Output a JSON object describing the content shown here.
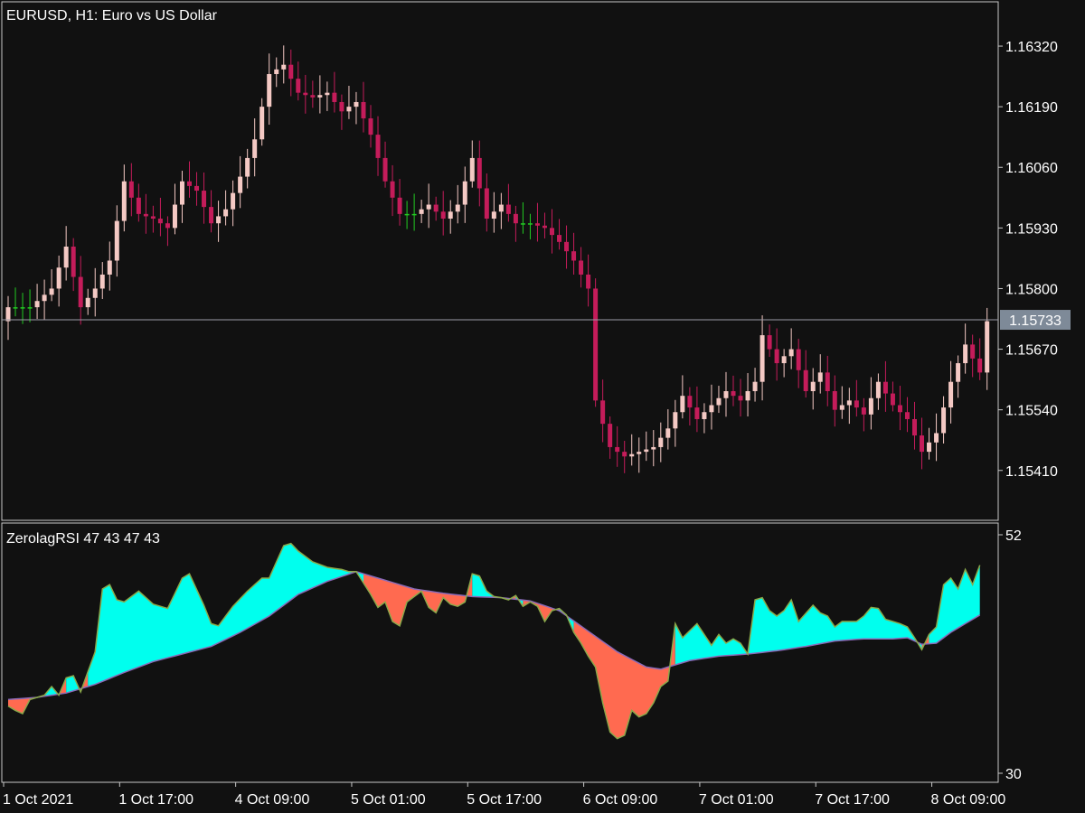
{
  "window": {
    "symbol_title": "EURUSD, H1:  Euro vs US Dollar",
    "indicator_title": "ZerolagRSI 47 43 47 43"
  },
  "colors": {
    "background": "#111111",
    "frame": "#c8c8c8",
    "bull_candle": "#f4c9c4",
    "bear_candle": "#c41c5a",
    "doji_candle": "#22cc22",
    "bid_line": "#9a9aa6",
    "price_badge": "#7e8a98",
    "rsi_up_fill": "#00ffee",
    "rsi_down_fill": "#ff6a50",
    "rsi_line": "#8aa84a",
    "signal_line": "#8a6ab8"
  },
  "chart_data": [
    {
      "type": "candlestick",
      "title": "EURUSD, H1:  Euro vs US Dollar",
      "ylim": [
        1.15303,
        1.16415
      ],
      "ytick_values": [
        1.1632,
        1.1619,
        1.1606,
        1.1593,
        1.158,
        1.1567,
        1.1554,
        1.1541
      ],
      "ytick_labels": [
        "1.16320",
        "1.16190",
        "1.16060",
        "1.15930",
        "1.15800",
        "1.15670",
        "1.15540",
        "1.15410"
      ],
      "current_price": 1.15733,
      "current_price_label": "1.15733",
      "xtick_labels": [
        "1 Oct 2021",
        "1 Oct 17:00",
        "4 Oct 09:00",
        "5 Oct 01:00",
        "5 Oct 17:00",
        "6 Oct 09:00",
        "7 Oct 01:00",
        "7 Oct 17:00",
        "8 Oct 09:00"
      ],
      "xtick_bar_index": [
        0,
        16,
        32,
        48,
        64,
        80,
        96,
        112,
        128
      ],
      "anchors": {
        "close": [
          [
            0,
            1.1576
          ],
          [
            3,
            1.1576
          ],
          [
            6,
            1.158
          ],
          [
            8,
            1.1589
          ],
          [
            10,
            1.1576
          ],
          [
            12,
            1.158
          ],
          [
            14,
            1.1586
          ],
          [
            16,
            1.1603
          ],
          [
            18,
            1.1596
          ],
          [
            20,
            1.1595
          ],
          [
            22,
            1.1593
          ],
          [
            24,
            1.1603
          ],
          [
            26,
            1.1601
          ],
          [
            28,
            1.1594
          ],
          [
            30,
            1.1597
          ],
          [
            32,
            1.1604
          ],
          [
            34,
            1.1612
          ],
          [
            36,
            1.1626
          ],
          [
            38,
            1.1628
          ],
          [
            40,
            1.1622
          ],
          [
            42,
            1.1621
          ],
          [
            44,
            1.1622
          ],
          [
            46,
            1.1618
          ],
          [
            48,
            1.162
          ],
          [
            50,
            1.1613
          ],
          [
            52,
            1.1603
          ],
          [
            54,
            1.1596
          ],
          [
            56,
            1.1596
          ],
          [
            58,
            1.1598
          ],
          [
            60,
            1.1595
          ],
          [
            62,
            1.1598
          ],
          [
            64,
            1.1608
          ],
          [
            66,
            1.1595
          ],
          [
            68,
            1.1598
          ],
          [
            70,
            1.1594
          ],
          [
            72,
            1.1594
          ],
          [
            74,
            1.1593
          ],
          [
            76,
            1.159
          ],
          [
            78,
            1.1586
          ],
          [
            80,
            1.158
          ],
          [
            81,
            1.1556
          ],
          [
            83,
            1.1546
          ],
          [
            85,
            1.1544
          ],
          [
            87,
            1.1545
          ],
          [
            89,
            1.1546
          ],
          [
            91,
            1.155
          ],
          [
            93,
            1.1557
          ],
          [
            95,
            1.1552
          ],
          [
            97,
            1.1555
          ],
          [
            99,
            1.1558
          ],
          [
            101,
            1.1556
          ],
          [
            103,
            1.156
          ],
          [
            104,
            1.157
          ],
          [
            106,
            1.1564
          ],
          [
            108,
            1.1567
          ],
          [
            110,
            1.1558
          ],
          [
            112,
            1.1562
          ],
          [
            114,
            1.1554
          ],
          [
            116,
            1.1556
          ],
          [
            118,
            1.1553
          ],
          [
            120,
            1.156
          ],
          [
            122,
            1.1555
          ],
          [
            124,
            1.1552
          ],
          [
            126,
            1.1545
          ],
          [
            128,
            1.1549
          ],
          [
            130,
            1.156
          ],
          [
            132,
            1.1568
          ],
          [
            134,
            1.1562
          ],
          [
            135,
            1.1573
          ]
        ]
      }
    },
    {
      "type": "area",
      "title": "ZerolagRSI 47 43 47 43",
      "ylim": [
        30,
        52
      ],
      "ytick_labels": [
        "52",
        "30"
      ],
      "series": [
        {
          "anchors": [
            [
              0,
              36.2
            ],
            [
              1,
              35.8
            ],
            [
              2,
              35.5
            ],
            [
              3,
              36.8
            ],
            [
              5,
              37.2
            ],
            [
              6,
              38.0
            ],
            [
              7,
              37.2
            ],
            [
              8,
              38.8
            ],
            [
              9,
              39.0
            ],
            [
              10,
              37.5
            ],
            [
              12,
              41.2
            ],
            [
              13,
              47.0
            ],
            [
              14,
              47.4
            ],
            [
              15,
              46.0
            ],
            [
              16,
              45.8
            ],
            [
              18,
              46.8
            ],
            [
              20,
              45.6
            ],
            [
              22,
              45.2
            ],
            [
              24,
              48.0
            ],
            [
              25,
              48.4
            ],
            [
              27,
              45.5
            ],
            [
              28,
              43.8
            ],
            [
              29,
              43.6
            ],
            [
              31,
              45.4
            ],
            [
              33,
              46.8
            ],
            [
              35,
              48.0
            ],
            [
              36,
              48.0
            ],
            [
              38,
              51.0
            ],
            [
              39,
              51.2
            ],
            [
              40,
              50.5
            ],
            [
              42,
              49.5
            ],
            [
              44,
              49.0
            ],
            [
              46,
              48.8
            ],
            [
              47,
              48.6
            ],
            [
              48,
              48.6
            ],
            [
              50,
              46.5
            ],
            [
              51,
              45.3
            ],
            [
              52,
              45.8
            ],
            [
              53,
              44.0
            ],
            [
              54,
              43.6
            ],
            [
              55,
              45.8
            ],
            [
              57,
              46.8
            ],
            [
              58,
              45.3
            ],
            [
              59,
              44.8
            ],
            [
              60,
              46.2
            ],
            [
              61,
              45.6
            ],
            [
              62,
              45.4
            ],
            [
              63,
              45.8
            ],
            [
              64,
              48.4
            ],
            [
              65,
              48.2
            ],
            [
              66,
              46.8
            ],
            [
              67,
              46.3
            ],
            [
              68,
              46.2
            ],
            [
              69,
              46.0
            ],
            [
              70,
              46.4
            ],
            [
              71,
              45.4
            ],
            [
              72,
              45.8
            ],
            [
              73,
              45.4
            ],
            [
              74,
              44.0
            ],
            [
              75,
              45.0
            ],
            [
              76,
              45.2
            ],
            [
              77,
              44.6
            ],
            [
              78,
              43.0
            ],
            [
              79,
              42.0
            ],
            [
              80,
              40.8
            ],
            [
              81,
              39.8
            ],
            [
              82,
              36.5
            ],
            [
              83,
              33.8
            ],
            [
              84,
              33.2
            ],
            [
              85,
              33.5
            ],
            [
              86,
              35.8
            ],
            [
              87,
              35.2
            ],
            [
              88,
              35.5
            ],
            [
              89,
              36.5
            ],
            [
              90,
              38.0
            ],
            [
              91,
              38.5
            ],
            [
              92,
              43.8
            ],
            [
              93,
              42.5
            ],
            [
              95,
              43.8
            ],
            [
              97,
              41.8
            ],
            [
              98,
              42.8
            ],
            [
              99,
              42.0
            ],
            [
              100,
              42.4
            ],
            [
              101,
              42.0
            ],
            [
              102,
              41.0
            ],
            [
              103,
              46.0
            ],
            [
              104,
              46.2
            ],
            [
              105,
              45.0
            ],
            [
              106,
              44.5
            ],
            [
              107,
              45.0
            ],
            [
              108,
              46.0
            ],
            [
              109,
              44.0
            ],
            [
              111,
              45.5
            ],
            [
              112,
              44.8
            ],
            [
              113,
              44.5
            ],
            [
              114,
              43.5
            ],
            [
              115,
              44.0
            ],
            [
              117,
              44.0
            ],
            [
              118,
              44.5
            ],
            [
              119,
              45.3
            ],
            [
              120,
              45.2
            ],
            [
              121,
              44.2
            ],
            [
              123,
              43.8
            ],
            [
              124,
              43.5
            ],
            [
              125,
              42.5
            ],
            [
              126,
              41.4
            ],
            [
              127,
              42.8
            ],
            [
              128,
              43.5
            ],
            [
              129,
              47.4
            ],
            [
              130,
              48.0
            ],
            [
              131,
              47.0
            ],
            [
              132,
              48.8
            ],
            [
              133,
              47.4
            ],
            [
              134,
              49.2
            ]
          ]
        },
        {
          "anchors": [
            [
              0,
              36.8
            ],
            [
              4,
              37.0
            ],
            [
              8,
              37.4
            ],
            [
              12,
              38.2
            ],
            [
              16,
              39.3
            ],
            [
              20,
              40.3
            ],
            [
              24,
              41.0
            ],
            [
              28,
              41.7
            ],
            [
              32,
              43.0
            ],
            [
              36,
              44.5
            ],
            [
              40,
              46.5
            ],
            [
              44,
              47.7
            ],
            [
              48,
              48.6
            ],
            [
              52,
              47.8
            ],
            [
              56,
              47.0
            ],
            [
              60,
              46.6
            ],
            [
              64,
              46.3
            ],
            [
              68,
              46.2
            ],
            [
              72,
              45.9
            ],
            [
              76,
              45.0
            ],
            [
              80,
              43.1
            ],
            [
              84,
              41.2
            ],
            [
              88,
              39.8
            ],
            [
              90,
              39.6
            ],
            [
              94,
              40.4
            ],
            [
              98,
              40.8
            ],
            [
              102,
              41.0
            ],
            [
              106,
              41.3
            ],
            [
              110,
              41.7
            ],
            [
              114,
              42.2
            ],
            [
              118,
              42.4
            ],
            [
              122,
              42.4
            ],
            [
              124,
              42.5
            ],
            [
              126,
              41.9
            ],
            [
              128,
              42.0
            ],
            [
              130,
              43.0
            ],
            [
              132,
              43.8
            ],
            [
              134,
              44.6
            ]
          ]
        }
      ]
    }
  ]
}
